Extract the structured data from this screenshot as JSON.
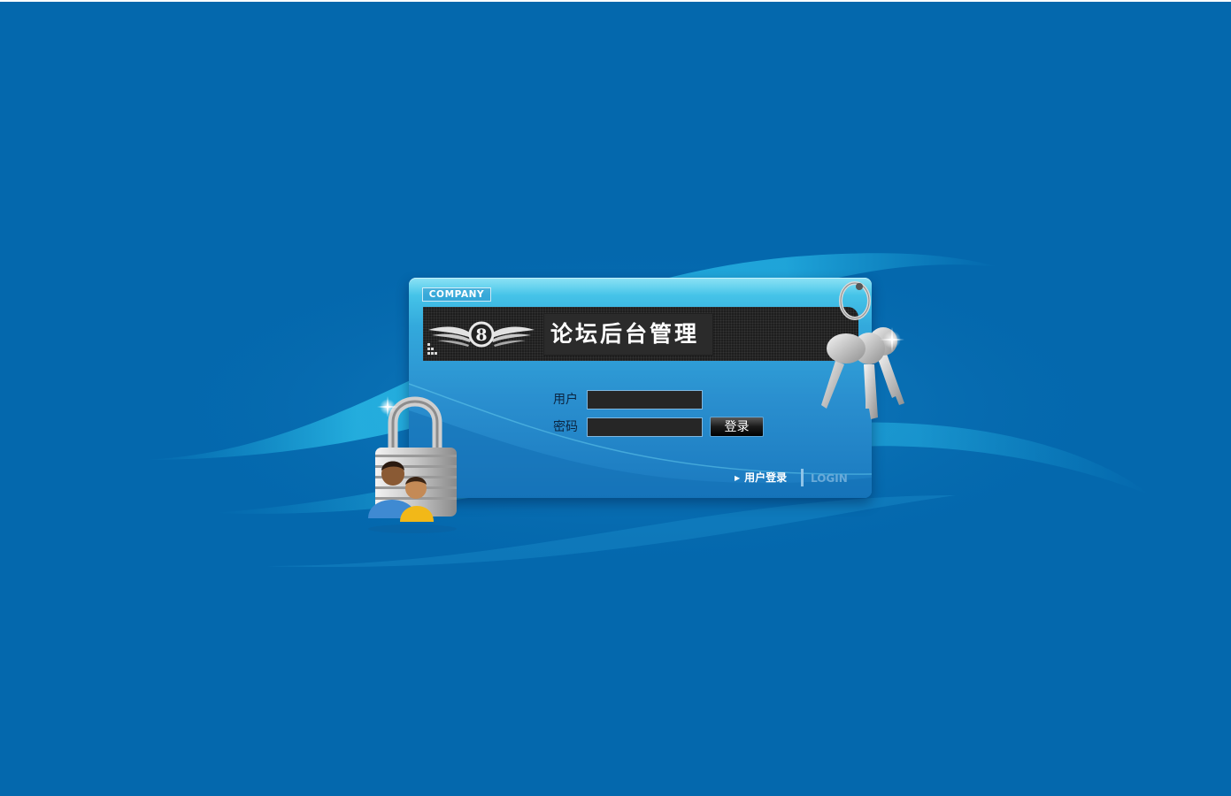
{
  "login_panel": {
    "company_badge": "COMPANY",
    "title": "论坛后台管理",
    "logo_letter": "8",
    "username_label": "用户",
    "password_label": "密码",
    "username_value": "",
    "password_value": "",
    "login_button": "登录",
    "user_login_link": "用户登录",
    "login_en": "LOGIN"
  },
  "icons": [
    "winged-logo-icon",
    "padlock-users-icon",
    "keys-icon",
    "arrow-right-icon"
  ],
  "colors": {
    "background": "#0468ad",
    "panel_top": "#4fd2ef",
    "panel_bottom": "#1a79bf",
    "title_bar": "#1e1e1e",
    "input_bg": "#262626",
    "label_text": "#0b2440"
  }
}
